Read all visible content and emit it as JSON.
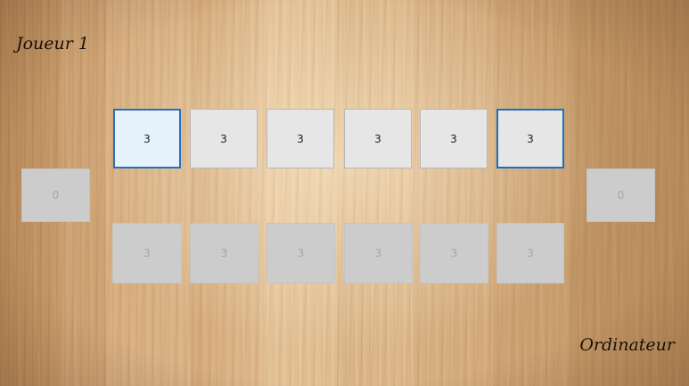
{
  "players": {
    "player1_label": "Joueur 1",
    "computer_label": "Ordinateur"
  },
  "stores": {
    "player1": "0",
    "computer": "0"
  },
  "top_row": {
    "pits": [
      "3",
      "3",
      "3",
      "3",
      "3",
      "3"
    ],
    "hovered_index": 0,
    "focused_index": 5
  },
  "bottom_row": {
    "pits": [
      "3",
      "3",
      "3",
      "3",
      "3",
      "3"
    ]
  },
  "colors": {
    "active_pit_bg": "#e6e6e6",
    "inactive_pit_bg": "#cccccc",
    "hover_pit_bg": "#e5f1fb",
    "focus_border": "#1f6fbe",
    "label_text": "#1a1008"
  }
}
